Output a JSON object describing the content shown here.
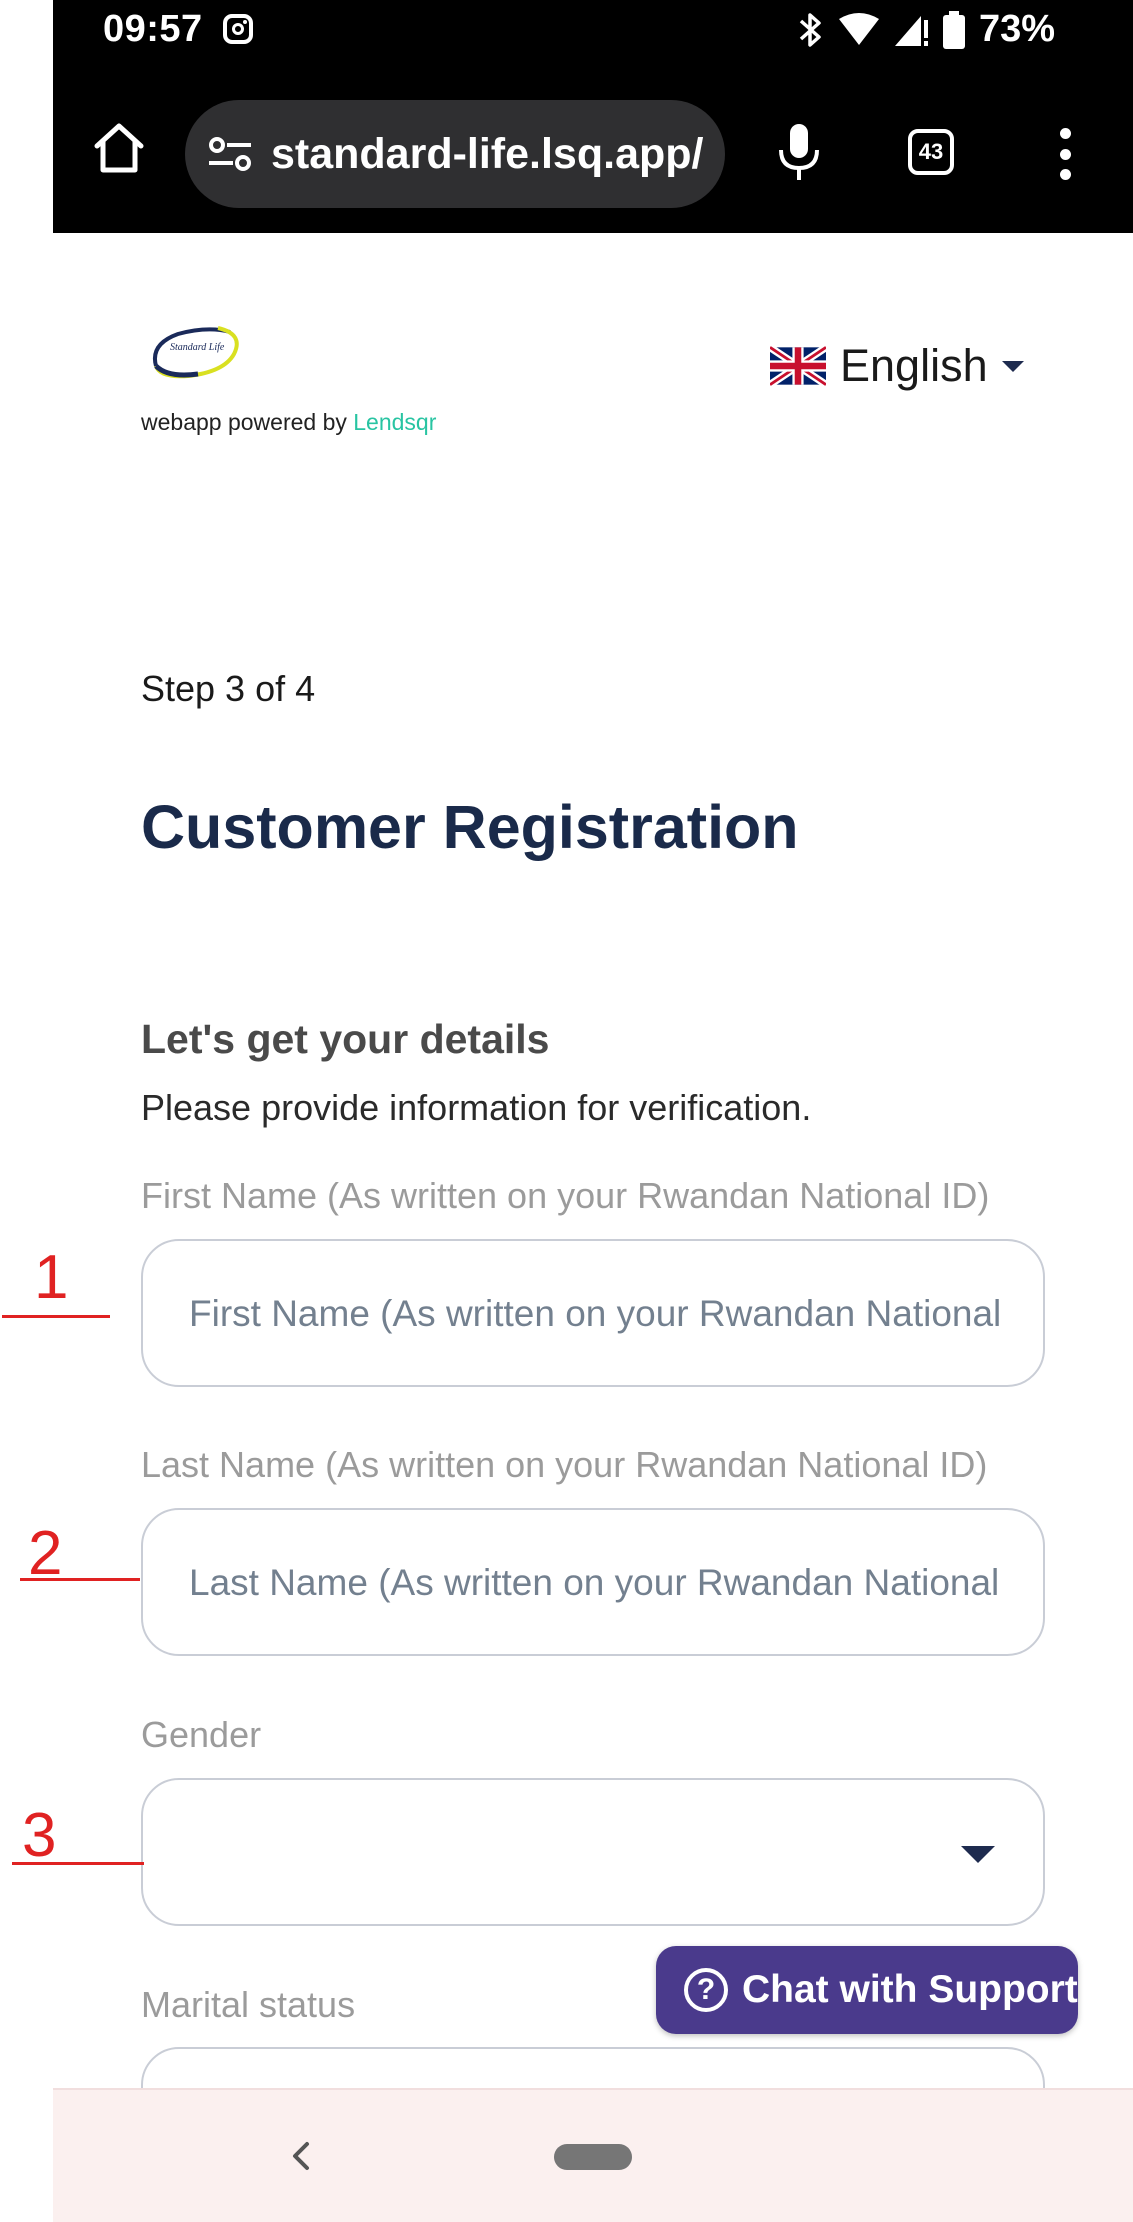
{
  "status_bar": {
    "time": "09:57",
    "battery": "73%",
    "icons": [
      "instagram-icon",
      "bluetooth-icon",
      "wifi-icon",
      "signal-icon",
      "battery-icon"
    ]
  },
  "browser": {
    "url": "standard-life.lsq.app/",
    "tab_count": "43",
    "icons": [
      "home-icon",
      "site-settings-icon",
      "mic-icon",
      "tabs-icon",
      "more-icon"
    ]
  },
  "header": {
    "logo_text": "Standard Life",
    "powered_prefix": "webapp powered by",
    "powered_brand": "Lendsqr",
    "language": "English",
    "language_flag": "uk-flag-icon"
  },
  "main": {
    "step": "Step 3 of 4",
    "title": "Customer Registration",
    "subheading": "Let's get your details",
    "description": "Please provide information for verification.",
    "fields": [
      {
        "label": "First Name (As written on your Rwandan National ID)",
        "placeholder": "First Name (As written on your Rwandan National ID)",
        "value": ""
      },
      {
        "label": "Last Name (As written on your Rwandan National ID)",
        "placeholder": "Last Name (As written on your Rwandan National ID)",
        "value": ""
      },
      {
        "label": "Gender",
        "value": ""
      },
      {
        "label": "Marital status",
        "value": ""
      }
    ]
  },
  "annotations": [
    "1",
    "2",
    "3"
  ],
  "chat": {
    "label": "Chat with Support"
  },
  "colors": {
    "title": "#1a2a4a",
    "brand_green": "#28c4a2",
    "chat_purple": "#4a3a8c",
    "annotation_red": "#e02222"
  }
}
